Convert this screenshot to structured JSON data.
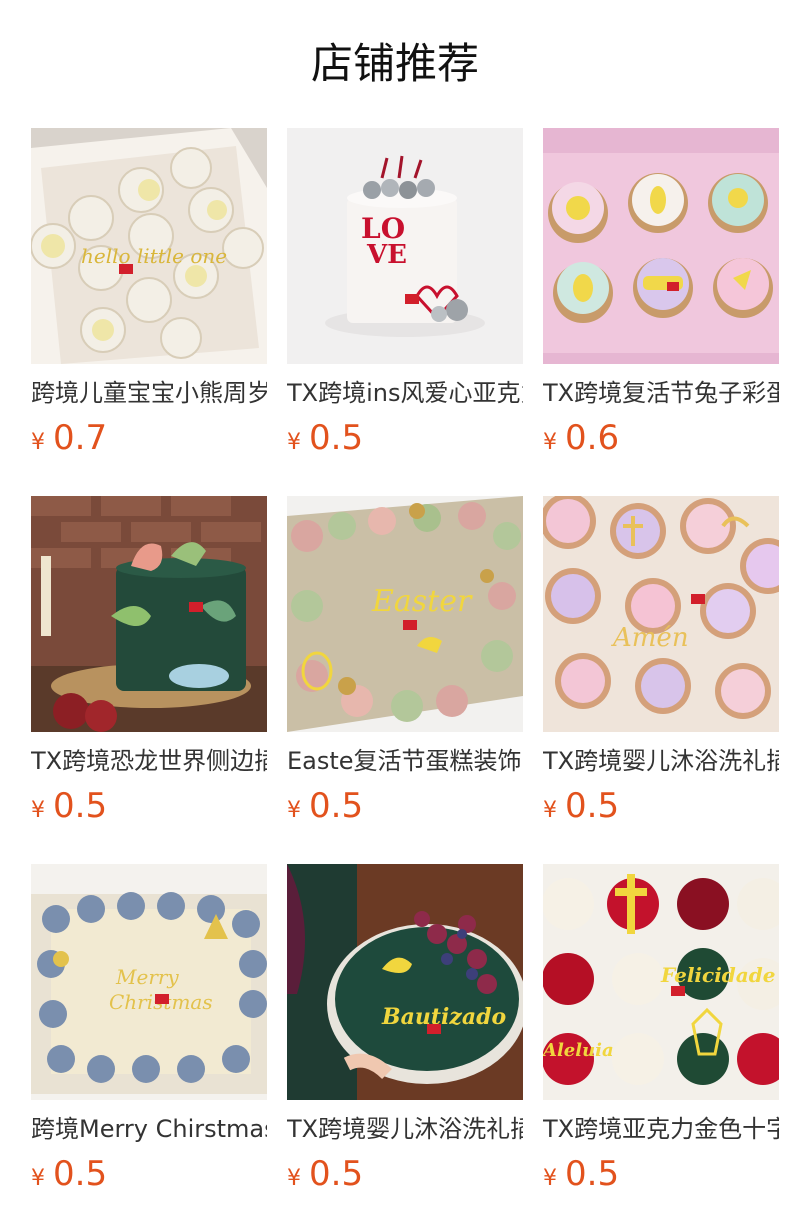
{
  "page": {
    "title": "店铺推荐",
    "price_color": "#e2521d"
  },
  "products": [
    {
      "name": "跨境儿童宝宝小熊周岁",
      "currency": "¥",
      "price": "0.7",
      "image": "cupcakes-baby-bear"
    },
    {
      "name": "TX跨境ins风爱心亚克力",
      "currency": "¥",
      "price": "0.5",
      "image": "love-cake-disco-balls"
    },
    {
      "name": "TX跨境复活节兔子彩蛋",
      "currency": "¥",
      "price": "0.6",
      "image": "easter-cupcakes-pink-box"
    },
    {
      "name": "TX跨境恐龙世界侧边插",
      "currency": "¥",
      "price": "0.5",
      "image": "dinosaur-green-cake"
    },
    {
      "name": "Easte复活节蛋糕装饰",
      "currency": "¥",
      "price": "0.5",
      "image": "easter-sheet-cake"
    },
    {
      "name": "TX跨境婴儿沐浴洗礼插",
      "currency": "¥",
      "price": "0.5",
      "image": "amen-cupcakes"
    },
    {
      "name": "跨境Merry Chirstmas",
      "currency": "¥",
      "price": "0.5",
      "image": "merry-christmas-cake"
    },
    {
      "name": "TX跨境婴儿沐浴洗礼插",
      "currency": "¥",
      "price": "0.5",
      "image": "bautizado-green-cake"
    },
    {
      "name": "TX跨境亚克力金色十字",
      "currency": "¥",
      "price": "0.5",
      "image": "cross-felicidade-cupcakes"
    }
  ]
}
